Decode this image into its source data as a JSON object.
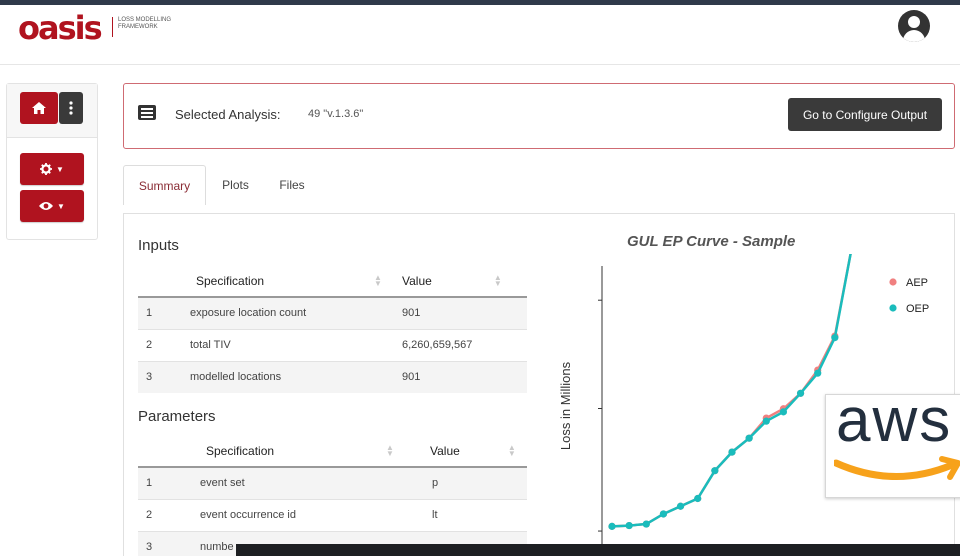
{
  "header": {
    "logo_text": "oasis",
    "logo_sub": "LOSS MODELLING FRAMEWORK"
  },
  "sidebar": {
    "home_icon": "home-icon",
    "menu_icon": "kebab-icon",
    "settings_dropdown": "gear-icon",
    "view_dropdown": "eye-icon"
  },
  "analysis": {
    "label": "Selected Analysis:",
    "value": "49 \"v.1.3.6\"",
    "configure_button": "Go to Configure Output"
  },
  "tabs": [
    {
      "label": "Summary",
      "active": true
    },
    {
      "label": "Plots",
      "active": false
    },
    {
      "label": "Files",
      "active": false
    }
  ],
  "inputs": {
    "title": "Inputs",
    "columns": [
      "Specification",
      "Value"
    ],
    "rows": [
      {
        "idx": "1",
        "spec": "exposure location count",
        "value": "901"
      },
      {
        "idx": "2",
        "spec": "total TIV",
        "value": "6,260,659,567"
      },
      {
        "idx": "3",
        "spec": "modelled locations",
        "value": "901"
      }
    ]
  },
  "parameters": {
    "title": "Parameters",
    "columns": [
      "Specification",
      "Value"
    ],
    "rows": [
      {
        "idx": "1",
        "spec": "event set",
        "value": "p"
      },
      {
        "idx": "2",
        "spec": "event occurrence id",
        "value": "lt"
      },
      {
        "idx": "3",
        "spec": "numbe",
        "value": ""
      }
    ]
  },
  "chart_data": {
    "type": "line",
    "title": "GUL EP Curve - Sample",
    "xlabel": "",
    "ylabel": "Loss in Millions",
    "legend_position": "top-right",
    "series": [
      {
        "name": "AEP",
        "color": "#f08080",
        "values": [
          0.3,
          0.35,
          0.45,
          1.1,
          1.6,
          2.1,
          3.9,
          5.1,
          6.0,
          7.3,
          7.9,
          8.9,
          10.4,
          12.6,
          18.4
        ]
      },
      {
        "name": "OEP",
        "color": "#1abcbc",
        "values": [
          0.3,
          0.35,
          0.45,
          1.1,
          1.6,
          2.1,
          3.9,
          5.1,
          6.0,
          7.1,
          7.7,
          8.9,
          10.2,
          12.5,
          18.4
        ]
      }
    ],
    "x": [
      1,
      2,
      3,
      4,
      5,
      6,
      7,
      8,
      9,
      10,
      11,
      12,
      13,
      14,
      15
    ],
    "ylim": [
      0,
      17
    ]
  },
  "overlay": {
    "brand": "aws"
  },
  "colors": {
    "brand_red": "#b0131f",
    "dark_button": "#3a3a3a",
    "aws_orange": "#f7a21b"
  }
}
